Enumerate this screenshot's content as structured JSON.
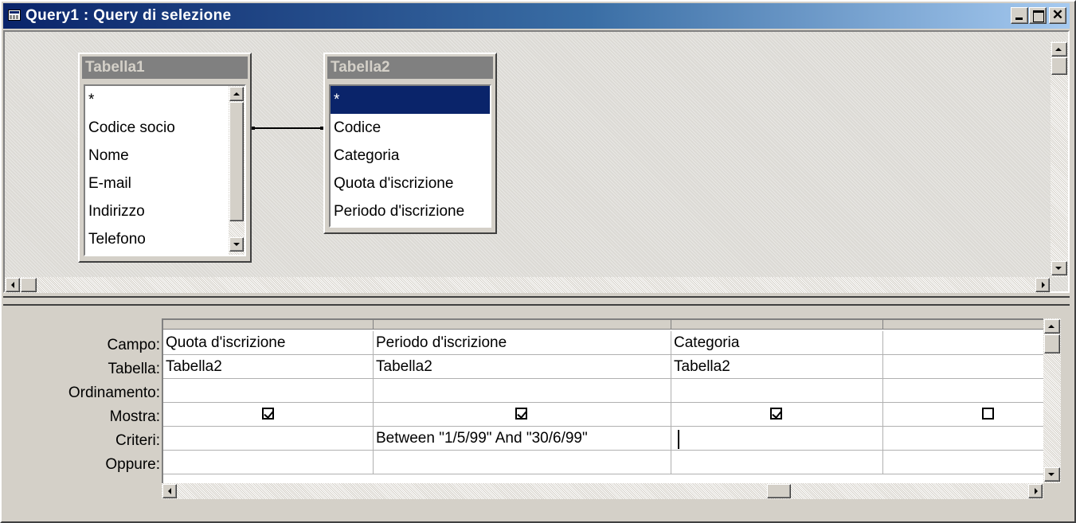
{
  "window": {
    "title": "Query1 : Query di selezione",
    "close_glyph": "✕"
  },
  "tables": [
    {
      "title": "Tabella1",
      "fields": [
        "*",
        "Codice socio",
        "Nome",
        "E-mail",
        "Indirizzo",
        "Telefono"
      ]
    },
    {
      "title": "Tabella2",
      "fields": [
        "*",
        "Codice",
        "Categoria",
        "Quota d'iscrizione",
        "Periodo d'iscrizione"
      ],
      "selected_index": 0
    }
  ],
  "grid": {
    "row_labels": [
      "Campo:",
      "Tabella:",
      "Ordinamento:",
      "Mostra:",
      "Criteri:",
      "Oppure:"
    ],
    "columns": [
      {
        "campo": "Quota d'iscrizione",
        "tabella": "Tabella2",
        "ordinamento": "",
        "mostra": true,
        "criteri": "",
        "oppure": ""
      },
      {
        "campo": "Periodo d'iscrizione",
        "tabella": "Tabella2",
        "ordinamento": "",
        "mostra": true,
        "criteri": "Between \"1/5/99\" And \"30/6/99\"",
        "oppure": ""
      },
      {
        "campo": "Categoria",
        "tabella": "Tabella2",
        "ordinamento": "",
        "mostra": true,
        "criteri": "",
        "oppure": ""
      },
      {
        "campo": "",
        "tabella": "",
        "ordinamento": "",
        "mostra": false,
        "criteri": "",
        "oppure": ""
      }
    ]
  },
  "icons": {
    "title_icon": "query-window-icon",
    "minimize": "minimize-icon",
    "maximize": "maximize-icon",
    "close": "close-icon"
  }
}
